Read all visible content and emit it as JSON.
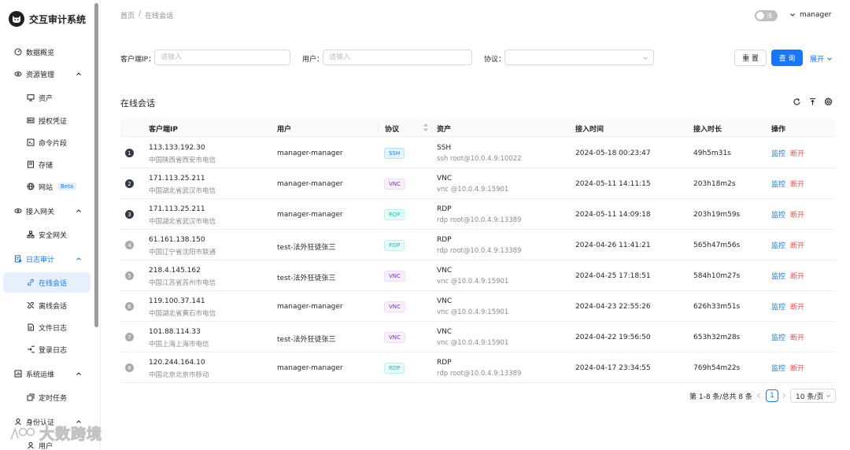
{
  "app": {
    "title": "交互审计系统"
  },
  "sidebar": {
    "items": [
      {
        "label": "数据概览",
        "icon": "dashboard-icon"
      },
      {
        "label": "资源管理",
        "icon": "resource-icon"
      },
      {
        "label": "资产",
        "icon": "desktop-icon"
      },
      {
        "label": "授权凭证",
        "icon": "credential-icon"
      },
      {
        "label": "命令片段",
        "icon": "code-icon"
      },
      {
        "label": "存储",
        "icon": "storage-icon"
      },
      {
        "label": "网站",
        "icon": "globe-icon",
        "badge": "Beta"
      },
      {
        "label": "接入网关",
        "icon": "gateway-icon"
      },
      {
        "label": "安全网关",
        "icon": "cluster-icon"
      },
      {
        "label": "日志审计",
        "icon": "audit-icon"
      },
      {
        "label": "在线会话",
        "icon": "link-icon"
      },
      {
        "label": "离线会话",
        "icon": "disconnect-icon"
      },
      {
        "label": "文件日志",
        "icon": "file-icon"
      },
      {
        "label": "登录日志",
        "icon": "login-icon"
      },
      {
        "label": "系统运维",
        "icon": "ops-icon"
      },
      {
        "label": "定时任务",
        "icon": "task-icon"
      },
      {
        "label": "身份认证",
        "icon": "identity-icon"
      },
      {
        "label": "用户",
        "icon": "user-icon"
      }
    ]
  },
  "header": {
    "breadcrumb": [
      "首页",
      "/",
      "在线会话"
    ],
    "theme_label": "浅",
    "username": "manager"
  },
  "filters": {
    "client_ip_label": "客户端IP",
    "client_ip_placeholder": "请输入",
    "user_label": "用户",
    "user_placeholder": "请输入",
    "protocol_label": "协议",
    "reset_label": "重 置",
    "query_label": "查 询",
    "expand_label": "展开"
  },
  "table": {
    "title": "在线会话",
    "columns": [
      "客户端IP",
      "用户",
      "协议",
      "资产",
      "接入时间",
      "接入时长",
      "操作"
    ],
    "action_monitor": "监控",
    "action_kick": "断开",
    "rows": [
      {
        "num": "1",
        "ip": "113.133.192.30",
        "location": "中国陕西省西安市电信",
        "user": "manager-manager",
        "protocol": "SSH",
        "asset": "SSH",
        "asset_detail": "ssh root@10.0.4.9:10022",
        "time": "2024-05-18 00:23:47",
        "duration": "49h5m31s"
      },
      {
        "num": "2",
        "ip": "171.113.25.211",
        "location": "中国湖北省武汉市电信",
        "user": "manager-manager",
        "protocol": "VNC",
        "asset": "VNC",
        "asset_detail": "vnc @10.0.4.9:15901",
        "time": "2024-05-11 14:11:15",
        "duration": "203h18m2s"
      },
      {
        "num": "3",
        "ip": "171.113.25.211",
        "location": "中国湖北省武汉市电信",
        "user": "manager-manager",
        "protocol": "RDP",
        "asset": "RDP",
        "asset_detail": "rdp root@10.0.4.9:13389",
        "time": "2024-05-11 14:09:18",
        "duration": "203h19m59s"
      },
      {
        "num": "4",
        "ip": "61.161.138.150",
        "location": "中国辽宁省沈阳市联通",
        "user": "test-法外狂徒张三",
        "protocol": "RDP",
        "asset": "RDP",
        "asset_detail": "rdp root@10.0.4.9:13389",
        "time": "2024-04-26 11:41:21",
        "duration": "565h47m56s"
      },
      {
        "num": "5",
        "ip": "218.4.145.162",
        "location": "中国江苏省苏州市电信",
        "user": "test-法外狂徒张三",
        "protocol": "VNC",
        "asset": "VNC",
        "asset_detail": "vnc @10.0.4.9:15901",
        "time": "2024-04-25 17:18:51",
        "duration": "584h10m27s"
      },
      {
        "num": "6",
        "ip": "119.100.37.141",
        "location": "中国湖北省黄石市电信",
        "user": "manager-manager",
        "protocol": "VNC",
        "asset": "VNC",
        "asset_detail": "vnc @10.0.4.9:15901",
        "time": "2024-04-23 22:55:26",
        "duration": "626h33m51s"
      },
      {
        "num": "7",
        "ip": "101.88.114.33",
        "location": "中国上海上海市电信",
        "user": "test-法外狂徒张三",
        "protocol": "VNC",
        "asset": "VNC",
        "asset_detail": "vnc @10.0.4.9:15901",
        "time": "2024-04-22 19:56:50",
        "duration": "653h32m28s"
      },
      {
        "num": "8",
        "ip": "120.244.164.10",
        "location": "中国北京北京市移动",
        "user": "manager-manager",
        "protocol": "RDP",
        "asset": "RDP",
        "asset_detail": "rdp root@10.0.4.9:13389",
        "time": "2024-04-17 23:34:55",
        "duration": "769h54m22s"
      }
    ]
  },
  "pagination": {
    "total_text": "第 1-8 条/总共 8 条",
    "current_page": "1",
    "page_size": "10 条/页"
  },
  "watermark": {
    "text": "大数跨境"
  },
  "colors": {
    "primary": "#1677ff",
    "danger": "#ff4d4f",
    "ssh_tag": "#1677ff",
    "vnc_tag": "#722ed1",
    "rdp_tag": "#13c2c2"
  }
}
